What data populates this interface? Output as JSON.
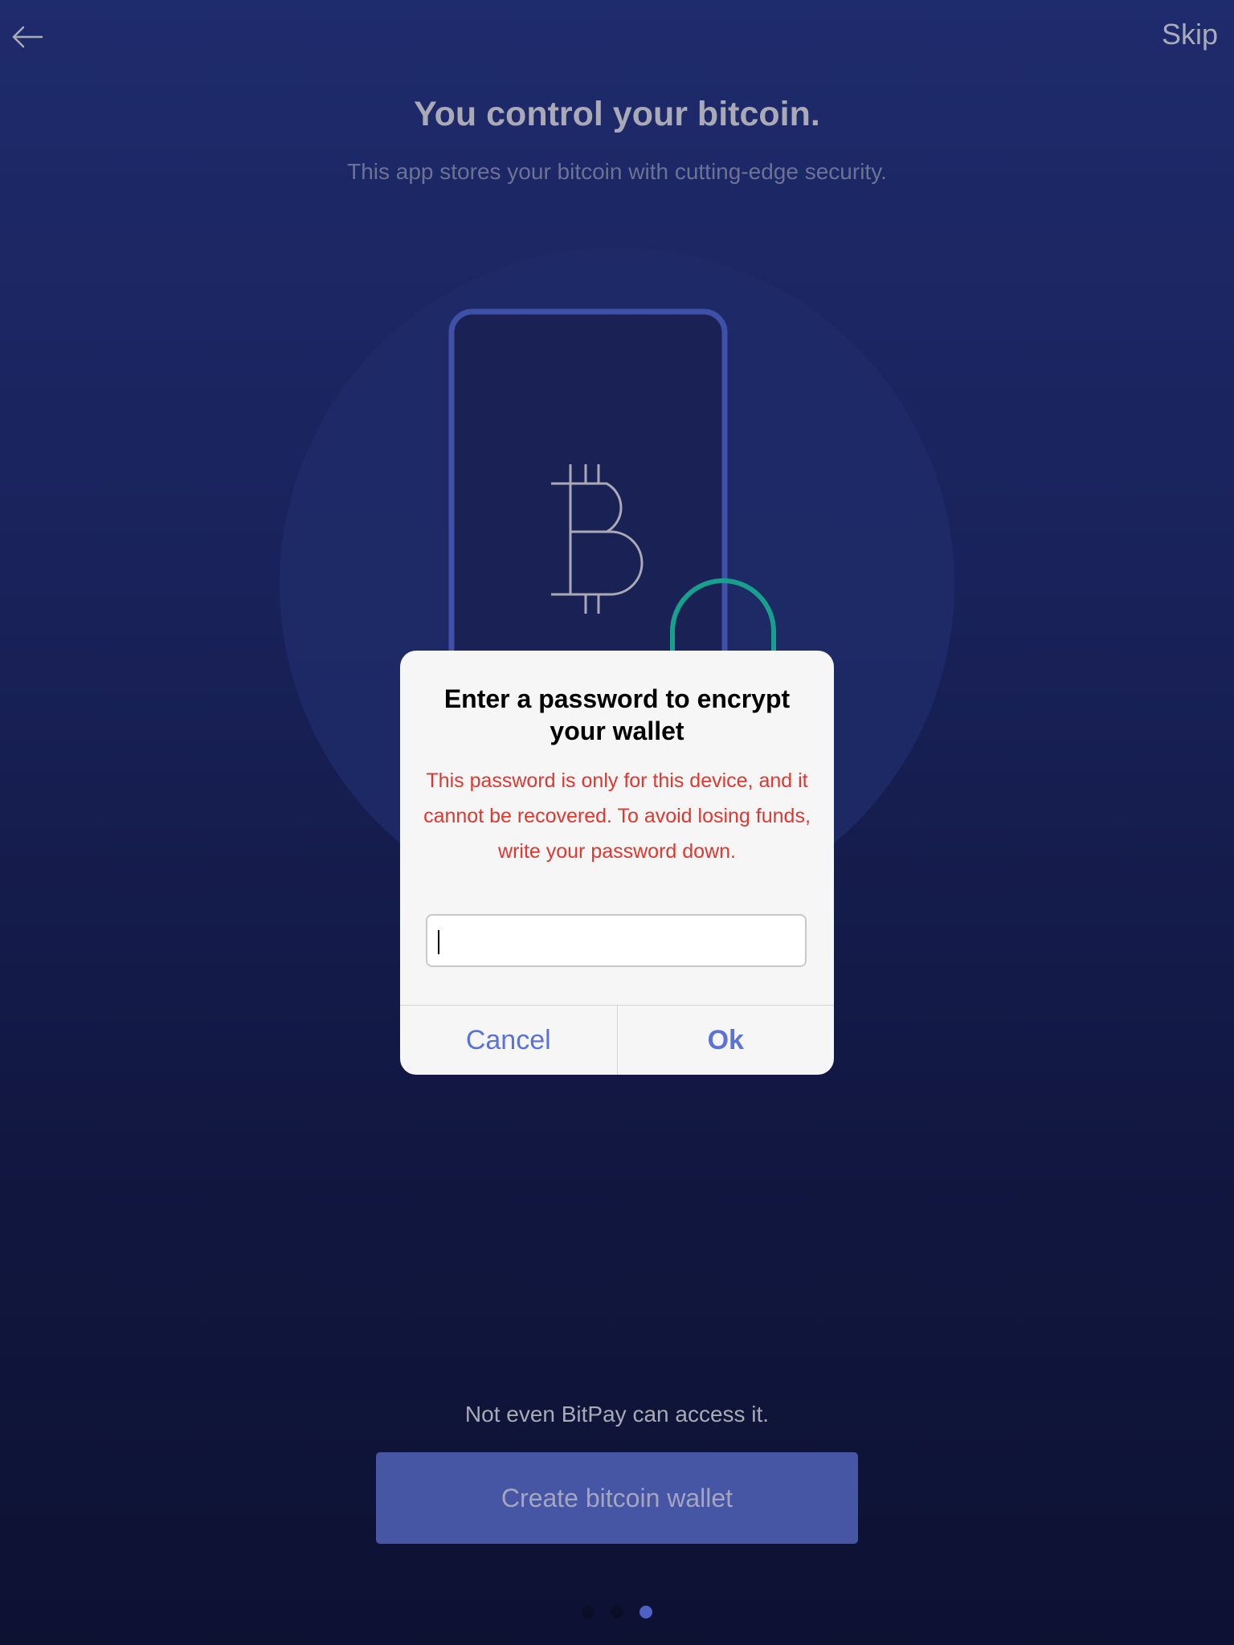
{
  "nav": {
    "back_icon": "arrow-left-icon",
    "skip_label": "Skip"
  },
  "hero": {
    "title": "You control your bitcoin.",
    "subtitle": "This app stores your bitcoin with cutting-edge security."
  },
  "illustration": {
    "icons": [
      "phone-icon",
      "bitcoin-icon",
      "padlock-icon"
    ],
    "colors": {
      "circle": "#1f2b69",
      "phone_border": "#3f50a8",
      "phone_fill": "#1a2255",
      "bitcoin": "#a9aab6",
      "lock": "#17a08c"
    }
  },
  "dialog": {
    "title": "Enter a password to encrypt your wallet",
    "message": "This password is only for this device, and it cannot be recovered. To avoid losing funds, write your password down.",
    "input_value": "",
    "cancel_label": "Cancel",
    "ok_label": "Ok"
  },
  "footer": {
    "text": "Not even BitPay can access it.",
    "cta_label": "Create bitcoin wallet"
  },
  "pager": {
    "count": 3,
    "active_index": 2
  },
  "colors": {
    "accent": "#5b73d8",
    "warning": "#e0372f",
    "cta": "#4656a4"
  }
}
